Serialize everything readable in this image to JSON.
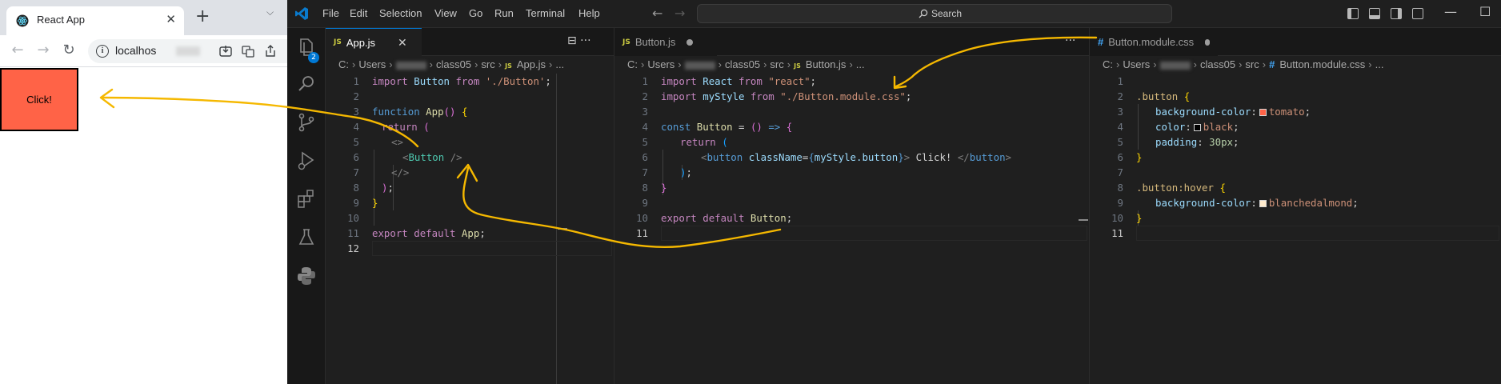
{
  "browser": {
    "tab_title": "React App",
    "tab_close": "✕",
    "new_tab": "+",
    "tab_menu": "⌵",
    "url": "localhos",
    "nav": {
      "back": "←",
      "forward": "→",
      "reload": "↻"
    },
    "page_button_label": "Click!"
  },
  "vscode": {
    "menu": [
      "File",
      "Edit",
      "Selection",
      "View",
      "Go",
      "Run",
      "Terminal",
      "Help"
    ],
    "nav_back": "←",
    "nav_forward": "→",
    "search_label": "Search",
    "window_controls": {
      "minimize": "—",
      "maximize": "☐"
    },
    "source_control_badge": "2",
    "colors": {
      "accent": "#0078d4",
      "tomato": "#ff6347",
      "black": "#000000",
      "blanchedalmond": "#ffebcd",
      "annotation": "#f5b800"
    },
    "groups": [
      {
        "tab": {
          "icon": "JS",
          "label": "App.js",
          "close": "✕",
          "actions": "⊟   ···"
        },
        "breadcrumb": [
          "C:",
          "Users",
          "class05",
          "src",
          "App.js",
          "..."
        ],
        "breadcrumb_icon": "JS",
        "lines": [
          "1",
          "2",
          "3",
          "4",
          "5",
          "6",
          "7",
          "8",
          "9",
          "10",
          "11",
          "12"
        ],
        "current_line": "12"
      },
      {
        "tab": {
          "icon": "JS",
          "label": "Button.js",
          "actions": "···"
        },
        "breadcrumb": [
          "C:",
          "Users",
          "class05",
          "src",
          "Button.js",
          "..."
        ],
        "breadcrumb_icon": "JS",
        "lines": [
          "1",
          "2",
          "3",
          "4",
          "5",
          "6",
          "7",
          "8",
          "9",
          "10",
          "11"
        ],
        "current_line": "11"
      },
      {
        "tab": {
          "icon": "#",
          "label": "Button.module.css"
        },
        "breadcrumb": [
          "C:",
          "Users",
          "class05",
          "src",
          "Button.module.css",
          "..."
        ],
        "breadcrumb_icon": "#",
        "lines": [
          "1",
          "2",
          "3",
          "4",
          "5",
          "6",
          "7",
          "8",
          "9",
          "10",
          "11"
        ],
        "current_line": "11"
      }
    ],
    "app_js": {
      "l1": {
        "import": "import",
        "name": "Button",
        "from": "from",
        "path": "'./Button'",
        "semi": ";"
      },
      "l3": {
        "function": "function",
        "name": "App",
        "parens": "()",
        "brace": "{"
      },
      "l4": {
        "return": "return",
        "paren": "("
      },
      "l5": {
        "frag": "<>"
      },
      "l6": {
        "open": "<",
        "tag": "Button",
        "close": "/>"
      },
      "l7": {
        "frag": "</>"
      },
      "l8": {
        "paren": ")",
        "semi": ";"
      },
      "l9": {
        "brace": "}"
      },
      "l11": {
        "export": "export",
        "default": "default",
        "name": "App",
        "semi": ";"
      }
    },
    "button_js": {
      "l1": {
        "import": "import",
        "name": "React",
        "from": "from",
        "path": "\"react\"",
        "semi": ";"
      },
      "l2": {
        "import": "import",
        "name": "myStyle",
        "from": "from",
        "path": "\"./Button.module.css\"",
        "semi": ";"
      },
      "l4": {
        "const": "const",
        "name": "Button",
        "eq": "=",
        "parens": "()",
        "arrow": "=>",
        "brace": "{"
      },
      "l5": {
        "return": "return",
        "paren": "("
      },
      "l6": {
        "open": "<",
        "tag": "button",
        "attr": "className",
        "eq": "=",
        "lb": "{",
        "expr": "myStyle.button",
        "rb": "}",
        "gt": ">",
        "text": " Click! ",
        "close_open": "</",
        "close_tag": "button",
        "close_gt": ">"
      },
      "l7": {
        "paren": ")",
        "semi": ";"
      },
      "l8": {
        "brace": "}"
      },
      "l10": {
        "export": "export",
        "default": "default",
        "name": "Button",
        "semi": ";"
      }
    },
    "button_css": {
      "l2": {
        "selector": ".button",
        "brace": "{"
      },
      "l3": {
        "prop": "background-color",
        "colon": ":",
        "value": "tomato",
        "semi": ";"
      },
      "l4": {
        "prop": "color",
        "colon": ":",
        "value": "black",
        "semi": ";"
      },
      "l5": {
        "prop": "padding",
        "colon": ":",
        "num": "30px",
        "semi": ";"
      },
      "l6": {
        "brace": "}"
      },
      "l8": {
        "selector": ".button:hover",
        "brace": "{"
      },
      "l9": {
        "prop": "background-color",
        "colon": ":",
        "value": "blanchedalmond",
        "semi": ";"
      },
      "l10": {
        "brace": "}"
      }
    }
  }
}
